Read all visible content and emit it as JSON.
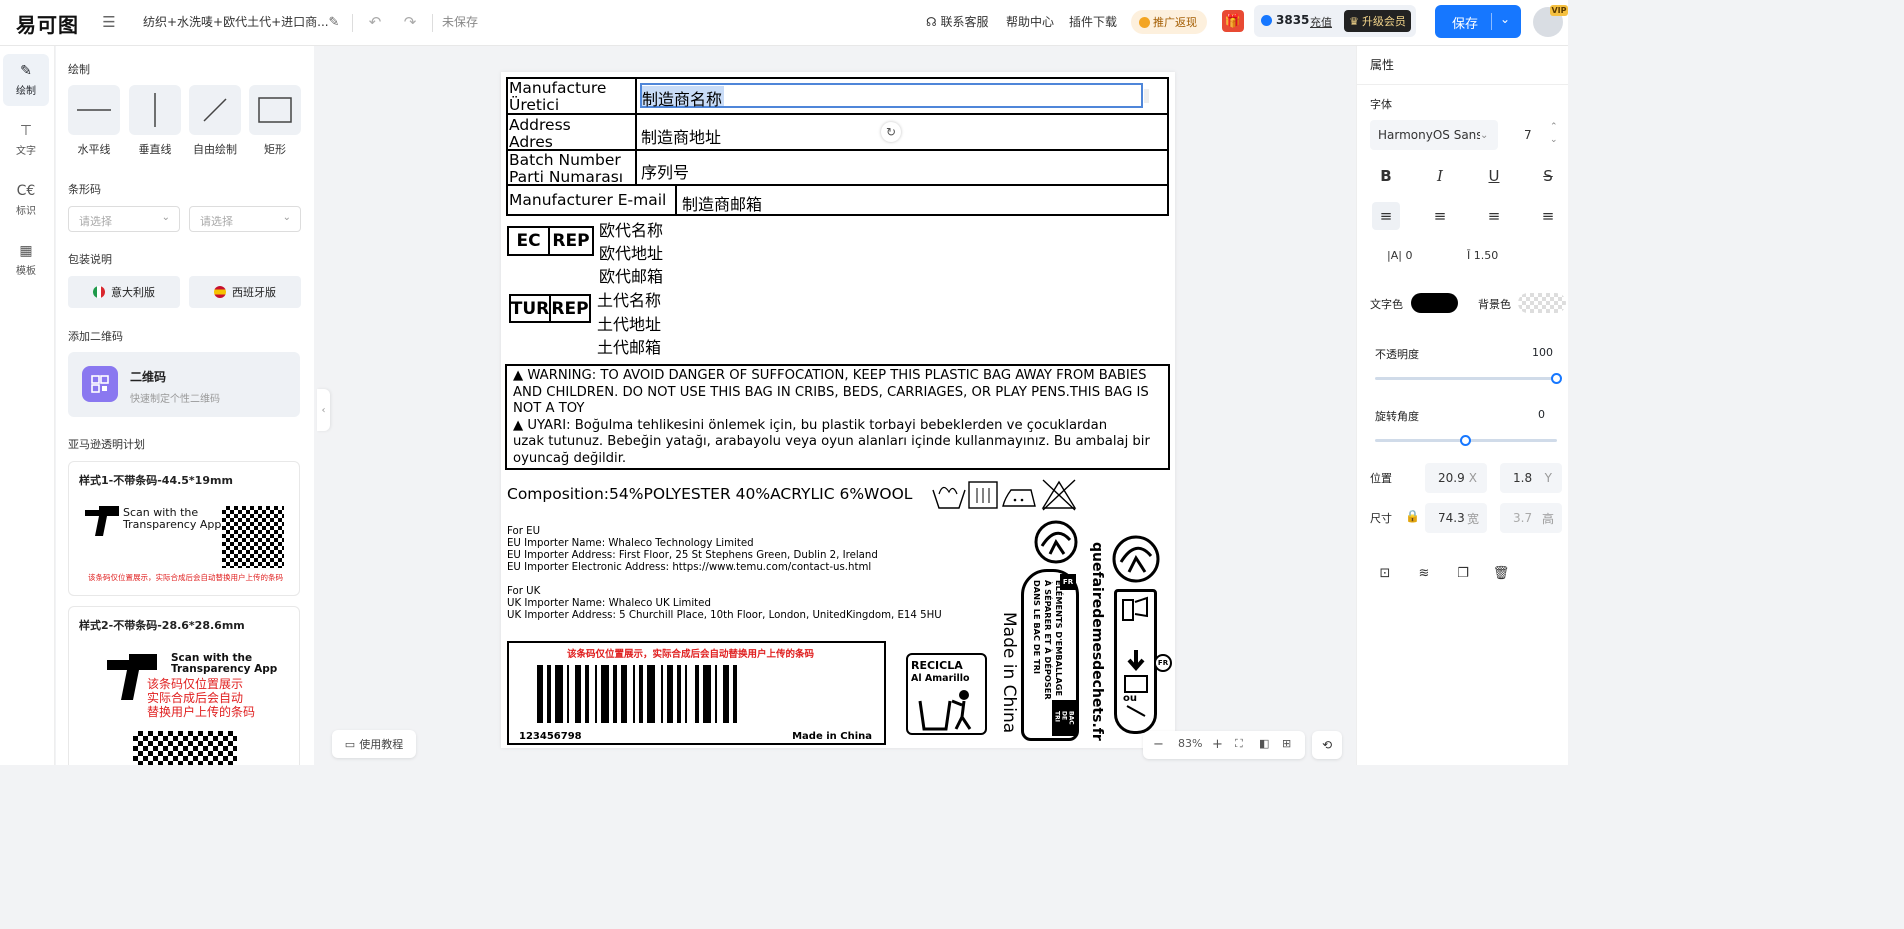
{
  "app": {
    "logo": "易可图",
    "doc_title": "纺织+水洗唛+欧代土代+进口商...",
    "save_state": "未保存"
  },
  "topbar": {
    "contact": "联系客服",
    "help": "帮助中心",
    "plugin": "插件下载",
    "promo": "推广返现",
    "coins": "3835",
    "recharge": "充值",
    "vip": "升级会员",
    "save": "保存",
    "vip_badge": "VIP"
  },
  "rail": {
    "items": [
      {
        "label": "绘制"
      },
      {
        "label": "文字"
      },
      {
        "label": "标识"
      },
      {
        "label": "模板"
      }
    ]
  },
  "panel": {
    "draw_title": "绘制",
    "tools": [
      {
        "label": "水平线"
      },
      {
        "label": "垂直线"
      },
      {
        "label": "自由绘制"
      },
      {
        "label": "矩形"
      }
    ],
    "barcode_title": "条形码",
    "select_placeholder_1": "请选择",
    "select_placeholder_2": "请选择",
    "packaging_title": "包装说明",
    "italy": "意大利版",
    "spain": "西班牙版",
    "qr_section": "添加二维码",
    "qr_title": "二维码",
    "qr_sub": "快速制定个性二维码",
    "amazon_section": "亚马逊透明计划",
    "style1": "样式1-不带条码-44.5*19mm",
    "style1_scan": "Scan with the\nTransparency App",
    "style1_note": "该条码仅位置展示，实际合成后会自动替换用户上传的条码",
    "style2": "样式2-不带条码-28.6*28.6mm",
    "style2_scan": "Scan with the\nTransparency App",
    "style2_red": "该条码仅位置展示\n实际合成后会自动\n替换用户上传的条码"
  },
  "canvas": {
    "rows": [
      {
        "label": "Manufacture\nÜretici",
        "value": "制造商名称"
      },
      {
        "label": "Address\nAdres",
        "value": "制造商地址"
      },
      {
        "label": "Batch Number\nParti Numarası",
        "value": "序列号"
      },
      {
        "label": "Manufacturer E-mail",
        "value": "制造商邮箱"
      }
    ],
    "ec": "EC",
    "rep": "REP",
    "tur": "TUR",
    "rep2": "REP",
    "eu_lines": [
      "欧代名称",
      "欧代地址",
      "欧代邮箱"
    ],
    "tr_lines": [
      "土代名称",
      "土代地址",
      "土代邮箱"
    ],
    "warning_en": "WARNING: TO AVOID DANGER OF SUFFOCATION, KEEP THIS PLASTIC BAG AWAY FROM BABIES AND CHILDREN. DO NOT USE THIS BAG IN CRIBS, BEDS, CARRIAGES, OR PLAY PENS.THIS BAG IS NOT A TOY",
    "warning_tr_1": "UYARI: Boğulma tehlikesini önlemek için, bu plastik torbayi bebeklerden ve çocuklardan",
    "warning_tr_2": "uzak tutunuz. Bebeğin yatağı, arabayolu veya oyun alanları içinde kullanmayınız. Bu ambalaj bir oyuncağ değildir.",
    "composition": "Composition:54%POLYESTER 40%ACRYLIC 6%WOOL",
    "importer_lines": [
      "For EU",
      "EU Importer Name: Whaleco Technology Limited",
      "EU Importer Address: First Floor, 25 St Stephens Green, Dublin 2, Ireland",
      "EU Importer Electronic Address: https://www.temu.com/contact-us.html",
      "",
      "For UK",
      "UK Importer Name: Whaleco UK Limited",
      "UK Importer Address: 5 Churchill Place, 10th Floor, London, UnitedKingdom, E14 5HU"
    ],
    "barcode_note": "该条码仅位置展示，实际合成后会自动替换用户上传的条码",
    "barcode_number": "123456798",
    "barcode_made": "Made in China",
    "recicla_1": "RECICLA",
    "recicla_2": "Al Amarillo",
    "made_in_china": "Made in China",
    "triman_text": "ÉLÉMENTS D'EMBALLAGE\nÀ SÉPARER ET À DÉPOSER\nDANS LE BAC DE TRI",
    "bac": "BAC\nDE\nTRI",
    "fr": "FR",
    "fr2": "FR",
    "ou": "ou",
    "website": "quefairedemesdechets.fr"
  },
  "bottom": {
    "tutorial": "使用教程",
    "zoom": "83%"
  },
  "props": {
    "title": "属性",
    "font_title": "字体",
    "font_name": "HarmonyOS Sans",
    "font_size": "7",
    "letter_spacing": "0",
    "line_height": "1.50",
    "text_color_label": "文字色",
    "bg_color_label": "背景色",
    "text_color": "#000000",
    "opacity_label": "不透明度",
    "opacity_value": "100",
    "opacity": 1.0,
    "rotation_label": "旋转角度",
    "rotation_value": "0",
    "rotation_fraction": 0.5,
    "position_label": "位置",
    "pos_x": "20.9",
    "pos_y": "1.8",
    "x_unit": "X",
    "y_unit": "Y",
    "size_label": "尺寸",
    "width": "74.3",
    "height": "3.7",
    "w_unit": "宽",
    "h_unit": "高"
  },
  "colors": {
    "accent": "#1677ff",
    "selection": "#c9dcf7"
  }
}
